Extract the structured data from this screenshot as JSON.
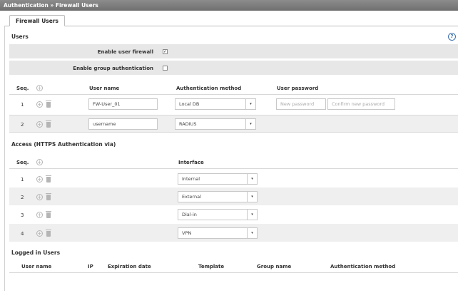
{
  "breadcrumb": "Authentication » Firewall Users",
  "tab": "Firewall Users",
  "users_section": {
    "title": "Users",
    "enable_user_firewall": {
      "label": "Enable user firewall",
      "checked": true
    },
    "enable_group_auth": {
      "label": "Enable group authentication",
      "checked": false
    },
    "columns": {
      "seq": "Seq.",
      "username": "User name",
      "auth": "Authentication method",
      "password": "User password"
    },
    "rows": [
      {
        "seq": "1",
        "username": "FW-User_01",
        "auth": "Local DB",
        "password_placeholder": "New password",
        "confirm_placeholder": "Confirm new password"
      },
      {
        "seq": "2",
        "username": "username",
        "auth": "RADIUS"
      }
    ]
  },
  "access_section": {
    "title": "Access (HTTPS Authentication via)",
    "columns": {
      "seq": "Seq.",
      "interface": "Interface"
    },
    "rows": [
      {
        "seq": "1",
        "interface": "Internal"
      },
      {
        "seq": "2",
        "interface": "External"
      },
      {
        "seq": "3",
        "interface": "Dial-in"
      },
      {
        "seq": "4",
        "interface": "VPN"
      }
    ]
  },
  "logged_section": {
    "title": "Logged in Users",
    "columns": {
      "username": "User name",
      "ip": "IP",
      "expiration": "Expiration date",
      "template": "Template",
      "group": "Group name",
      "auth": "Authentication method"
    }
  },
  "icons": {
    "help": "?",
    "add": "+",
    "checkmark": "✓",
    "arrow": "▾"
  }
}
